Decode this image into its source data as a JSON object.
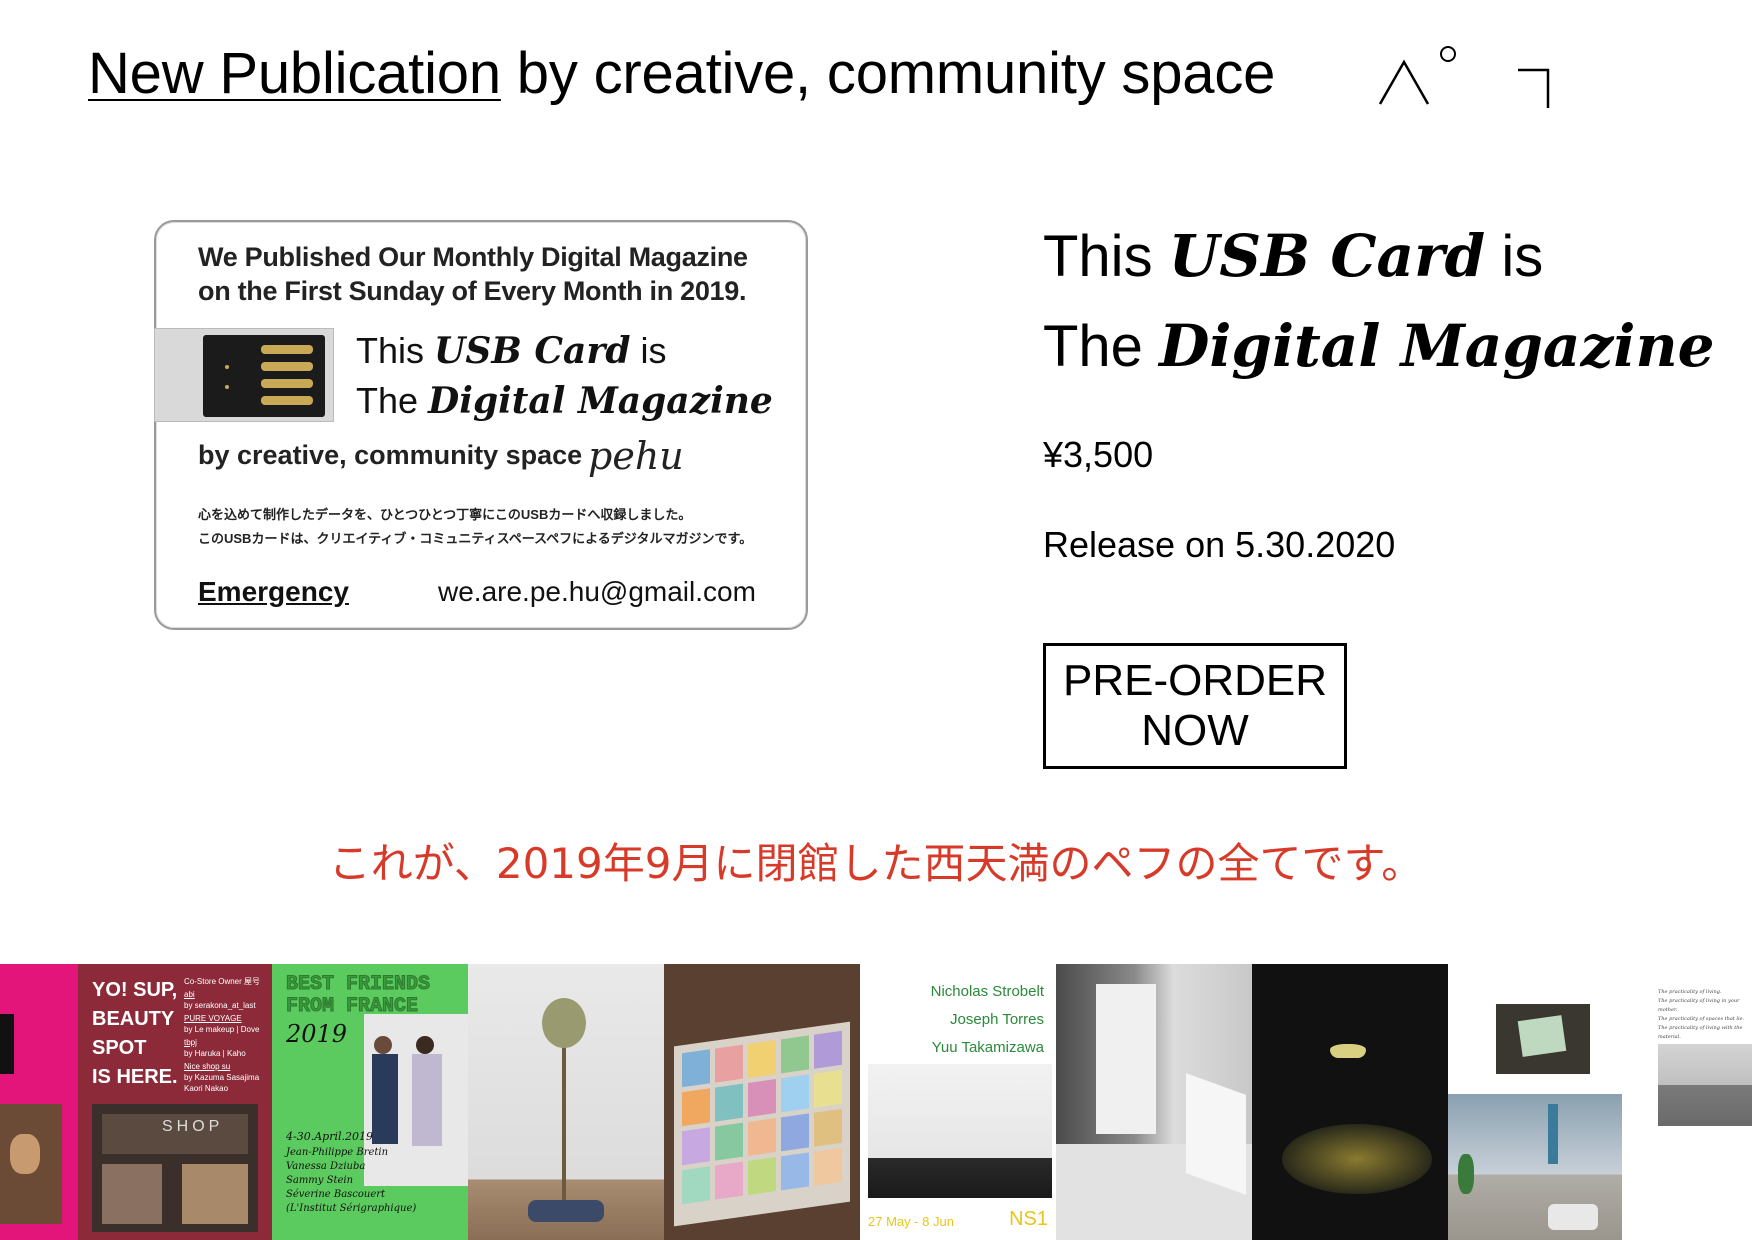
{
  "header": {
    "link_text": "New Publication",
    "rest_text": " by creative, community space"
  },
  "card": {
    "line1": "We Published Our Monthly Digital Magazine",
    "line2": "on the First Sunday of Every Month in 2019.",
    "title_prefix": "This ",
    "title_em": "USB Card",
    "title_suffix": " is",
    "title2_prefix": "The ",
    "title2_em": "Digital Magazine",
    "by_text": "by creative, community space",
    "signature": "pehu",
    "jp_line1": "心を込めて制作したデータを、ひとつひとつ丁寧にこのUSBカードへ収録しました。",
    "jp_line2": "このUSBカードは、クリエイティブ・コミュニティスペースペフによるデジタルマガジンです。",
    "emergency": "Emergency",
    "email": "we.are.pe.hu@gmail.com"
  },
  "product": {
    "title_prefix": "This ",
    "title_em": "USB Card",
    "title_suffix": " is",
    "title2_prefix": "The ",
    "title2_em": "Digital Magazine",
    "price": "¥3,500",
    "release": "Release on 5.30.2020",
    "button_label": "PRE-ORDER NOW"
  },
  "tagline": "これが、2019年9月に閉館した西天満のペフの全てです。",
  "gallery": {
    "tile2": {
      "title_lines": [
        "YO! SUP,",
        "BEAUTY",
        "SPOT",
        "IS HERE."
      ],
      "owner_label": "Co-Store Owner 屋号",
      "items": [
        {
          "name": "abi",
          "by": "by serakona_at_last"
        },
        {
          "name": "PURE VOYAGE",
          "by": "by Le makeup | Dove"
        },
        {
          "name": "tbpj",
          "by": "by Haruka | Kaho"
        },
        {
          "name": "Nice shop su",
          "by": "by Kazuma Sasajima Kaori Nakao"
        }
      ],
      "shop_sign": "SHOP"
    },
    "tile3": {
      "title_line1": "BEST FRIENDS",
      "title_line2": "FROM FRANCE",
      "year": "2019",
      "dates": "4-30.April.2019",
      "artists": [
        "Jean-Philippe Bretin",
        "Vanessa Dziuba",
        "Sammy Stein",
        "Séverine Bascouert",
        "(L'Institut Sérigraphique)"
      ]
    },
    "tile6": {
      "names": [
        "Nicholas Strobelt",
        "Joseph Torres",
        "Yuu Takamizawa"
      ],
      "dates": "27 May - 8 Jun",
      "code": "NS1"
    },
    "tile9": {
      "lines": [
        "The practicality of living.",
        "The practicality of living in your mother.",
        "The practicality of spaces that lie.",
        "The practicality of living with the material."
      ]
    }
  },
  "colors": {
    "tagline": "#d83a2a",
    "pink": "#e3157a",
    "maroon": "#8c2a3a",
    "green": "#5ccb5f",
    "ns1_yellow": "#e8c51c"
  }
}
